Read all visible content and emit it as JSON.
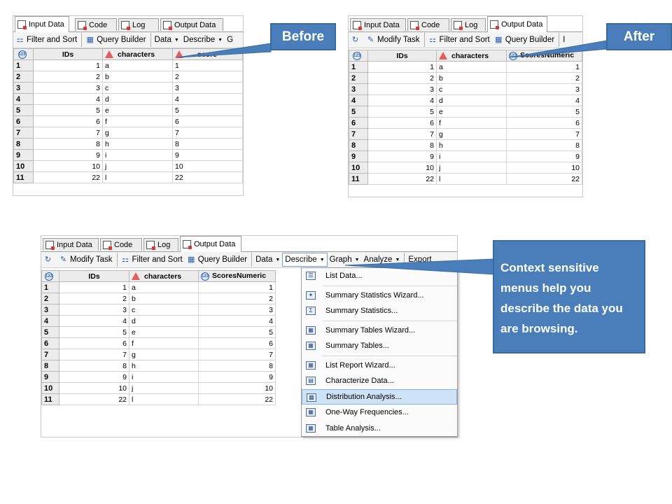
{
  "tabs": {
    "input": "Input Data",
    "code": "Code",
    "log": "Log",
    "output": "Output Data"
  },
  "toolbar": {
    "modify_task": "Modify Task",
    "filter_sort": "Filter and Sort",
    "query_builder": "Query Builder",
    "data": "Data",
    "describe": "Describe",
    "graph": "Graph",
    "analyze": "Analyze",
    "export": "Export",
    "trunc_g": "G",
    "trunc_i": "I"
  },
  "columns": {
    "ids": "IDs",
    "characters": "characters",
    "score": "score",
    "scores_numeric": "ScoresNumeric",
    "num_icon": "123"
  },
  "rows": [
    {
      "n": "1",
      "id": "1",
      "ch": "a",
      "sc": "1"
    },
    {
      "n": "2",
      "id": "2",
      "ch": "b",
      "sc": "2"
    },
    {
      "n": "3",
      "id": "3",
      "ch": "c",
      "sc": "3"
    },
    {
      "n": "4",
      "id": "4",
      "ch": "d",
      "sc": "4"
    },
    {
      "n": "5",
      "id": "5",
      "ch": "e",
      "sc": "5"
    },
    {
      "n": "6",
      "id": "6",
      "ch": "f",
      "sc": "6"
    },
    {
      "n": "7",
      "id": "7",
      "ch": "g",
      "sc": "7"
    },
    {
      "n": "8",
      "id": "8",
      "ch": "h",
      "sc": "8"
    },
    {
      "n": "9",
      "id": "9",
      "ch": "i",
      "sc": "9"
    },
    {
      "n": "10",
      "id": "10",
      "ch": "j",
      "sc": "10"
    },
    {
      "n": "11",
      "id": "22",
      "ch": "l",
      "sc": "22"
    }
  ],
  "callouts": {
    "before": "Before",
    "after": "After",
    "context": "Context sensitive menus help you describe the data you are browsing."
  },
  "menu": {
    "items": [
      "List Data...",
      "Summary Statistics Wizard...",
      "Summary Statistics...",
      "Summary Tables Wizard...",
      "Summary Tables...",
      "List Report Wizard...",
      "Characterize Data...",
      "Distribution Analysis...",
      "One-Way Frequencies...",
      "Table Analysis..."
    ],
    "highlighted": "Distribution Analysis..."
  },
  "colors": {
    "callout": "#4a7ebb",
    "highlight": "#cfe3f7",
    "alert": "#e65b5b",
    "numeric": "#3366aa"
  }
}
